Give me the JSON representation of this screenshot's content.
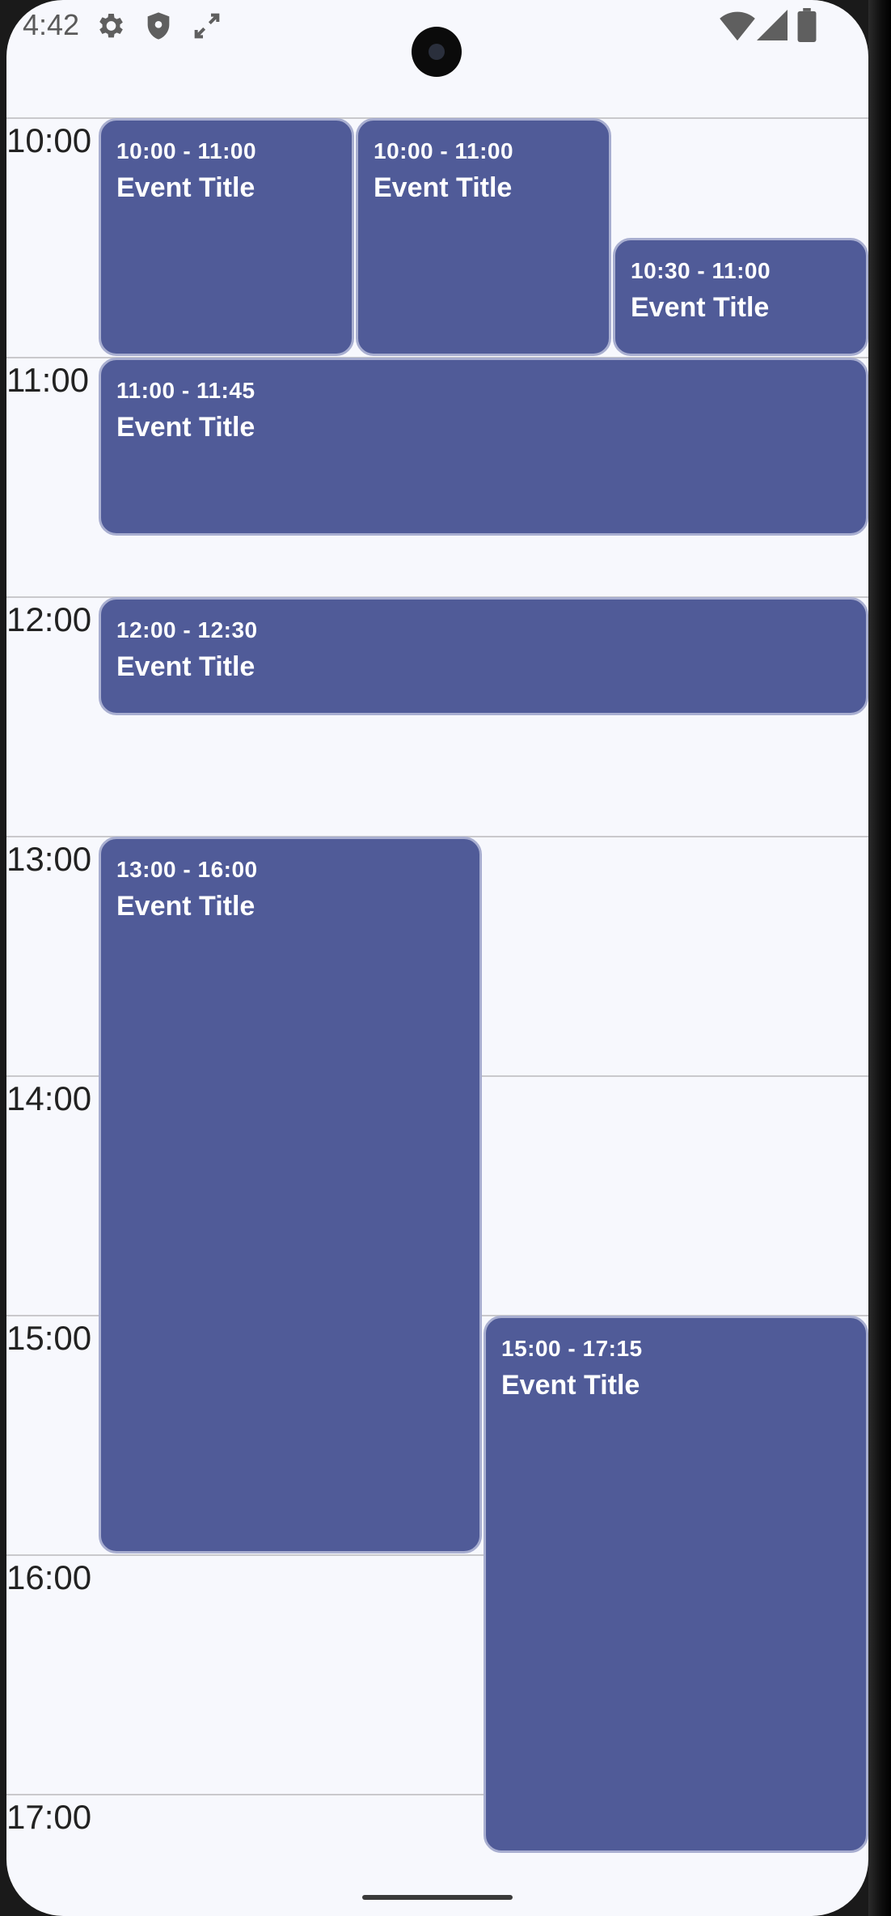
{
  "status_bar": {
    "time": "4:42",
    "left_icons": [
      "gear-icon",
      "shield-icon",
      "sync-arrows-icon"
    ],
    "right_icons": [
      "wifi-icon",
      "signal-icon",
      "battery-icon"
    ]
  },
  "hours": [
    "10:00",
    "11:00",
    "12:00",
    "13:00",
    "14:00",
    "15:00",
    "16:00",
    "17:00"
  ],
  "events": [
    {
      "time": "10:00 - 11:00",
      "title": "Event Title"
    },
    {
      "time": "10:00 - 11:00",
      "title": "Event Title"
    },
    {
      "time": "10:30 - 11:00",
      "title": "Event Title"
    },
    {
      "time": "11:00 - 11:45",
      "title": "Event Title"
    },
    {
      "time": "12:00 - 12:30",
      "title": "Event Title"
    },
    {
      "time": "13:00 - 16:00",
      "title": "Event Title"
    },
    {
      "time": "15:00 - 17:15",
      "title": "Event Title"
    }
  ],
  "colors": {
    "event_fill": "#505b98",
    "event_border": "#a8aed0",
    "background": "#f7f8fd",
    "grid_line": "#c9c9cc"
  }
}
